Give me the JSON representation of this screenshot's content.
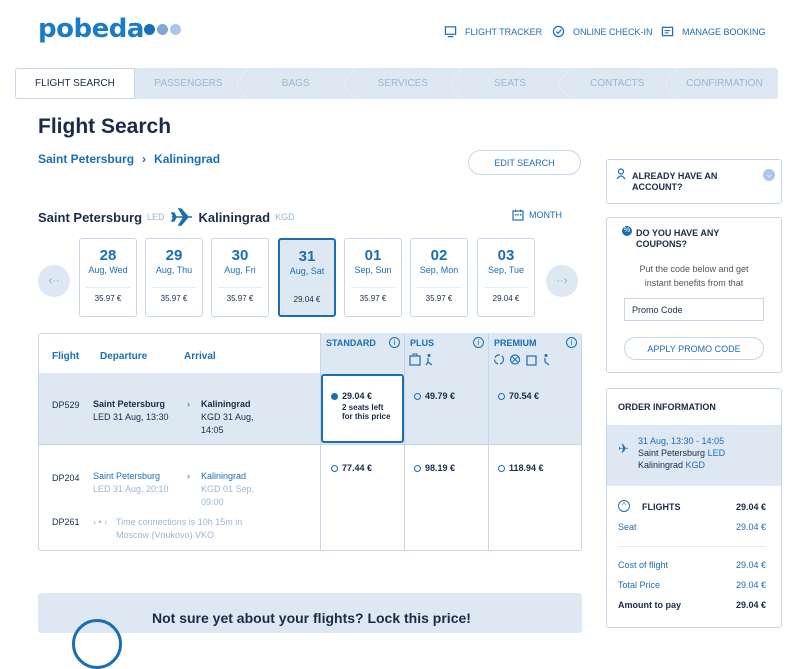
{
  "brand": {
    "logo_text": "pobeda",
    "colors": {
      "primary": "#1a6fb3",
      "light": "#dde8f3",
      "dark": "#1a2b49"
    }
  },
  "topnav": [
    {
      "icon": "monitor-icon",
      "label": "FLIGHT TRACKER"
    },
    {
      "icon": "check-circle-icon",
      "label": "ONLINE CHECK-IN"
    },
    {
      "icon": "booking-icon",
      "label": "MANAGE BOOKING"
    }
  ],
  "steps": [
    "FLIGHT SEARCH",
    "PASSENGERS",
    "BAGS",
    "SERVICES",
    "SEATS",
    "CONTACTS",
    "CONFIRMATION"
  ],
  "page_title": "Flight Search",
  "route": {
    "from": "Saint Petersburg",
    "to": "Kaliningrad"
  },
  "edit_search_label": "EDIT SEARCH",
  "direction": {
    "from": "Saint Petersburg",
    "from_code": "LED",
    "to": "Kaliningrad",
    "to_code": "KGD"
  },
  "month_label": "MONTH",
  "days": [
    {
      "num": "28",
      "wd": "Aug, Wed",
      "price": "35.97 €"
    },
    {
      "num": "29",
      "wd": "Aug, Thu",
      "price": "35.97 €"
    },
    {
      "num": "30",
      "wd": "Aug, Fri",
      "price": "35.97 €"
    },
    {
      "num": "31",
      "wd": "Aug, Sat",
      "price": "29.04 €"
    },
    {
      "num": "01",
      "wd": "Sep, Sun",
      "price": "35.97 €"
    },
    {
      "num": "02",
      "wd": "Sep, Mon",
      "price": "35.97 €"
    },
    {
      "num": "03",
      "wd": "Sep, Tue",
      "price": "29.04 €"
    }
  ],
  "table": {
    "headers": {
      "flight": "Flight",
      "departure": "Departure",
      "arrival": "Arrival"
    },
    "fares": [
      "STANDARD",
      "PLUS",
      "PREMIUM"
    ],
    "row1": {
      "flight": "DP529",
      "dep_city": "Saint Petersburg",
      "dep_time": "LED 31 Aug, 13:30",
      "arr_city": "Kaliningrad",
      "arr_time1": "KGD 31 Aug,",
      "arr_time2": "14:05",
      "standard": "29.04 €",
      "seats_left": "2 seats left",
      "seats_left2": "for this price",
      "plus": "49.79 €",
      "premium": "70.54 €"
    },
    "row2": {
      "flight": "DP204",
      "dep_city": "Saint Petersburg",
      "dep_time": "LED 31 Aug, 20:10",
      "arr_city": "Kaliningrad",
      "arr_time1": "KGD 01 Sep,",
      "arr_time2": "09:00",
      "flight2": "DP261",
      "connection1": "Time connections is 10h 15m in",
      "connection2": "Moscow (Vnukovo) VKO",
      "standard": "77.44 €",
      "plus": "98.19 €",
      "premium": "118.94 €"
    }
  },
  "account": {
    "label1": "ALREADY HAVE AN",
    "label2": "ACCOUNT?"
  },
  "coupons": {
    "title1": "DO YOU HAVE ANY",
    "title2": "COUPONS?",
    "desc1": "Put the code below and get",
    "desc2": "instant benefits from that",
    "placeholder": "Promo Code",
    "apply": "APPLY PROMO CODE"
  },
  "order": {
    "title": "ORDER INFORMATION",
    "flight_time": "31 Aug, 13:30 - 14:05",
    "flight_from": "Saint Petersburg",
    "from_code": "LED",
    "flight_to": "Kaliningrad",
    "to_code": "KGD",
    "flights_label": "FLIGHTS",
    "flights_value": "29.04 €",
    "seat_label": "Seat",
    "seat_value": "29.04 €",
    "cost_label": "Cost of flight",
    "cost_value": "29.04 €",
    "total_label": "Total Price",
    "total_value": "29.04 €",
    "pay_label": "Amount to pay",
    "pay_value": "29.04 €"
  },
  "banner": {
    "text": "Not sure yet about your flights? Lock this price!"
  }
}
